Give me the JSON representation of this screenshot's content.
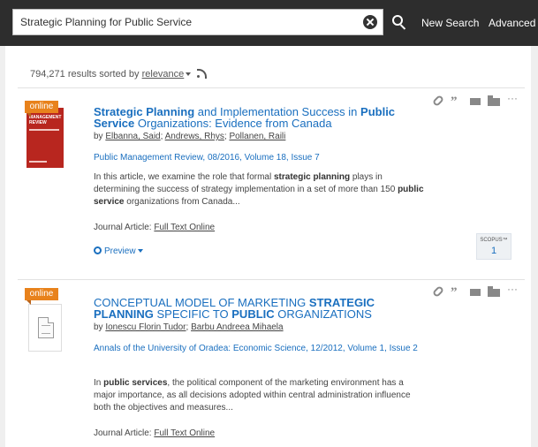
{
  "search": {
    "query": "Strategic Planning for Public Service",
    "new_search_label": "New Search",
    "advanced_label": "Advanced"
  },
  "summary": {
    "count_text": "794,271 results sorted by",
    "sort_value": "relevance"
  },
  "results": [
    {
      "badge": "online",
      "cover_text": "MANAGEMENT REVIEW",
      "title_segments": [
        {
          "text": "Strategic Planning",
          "bold": true
        },
        {
          "text": " and Implementation Success in ",
          "bold": false
        },
        {
          "text": "Public Service",
          "bold": true
        },
        {
          "text": " Organizations: Evidence from Canada",
          "bold": false
        }
      ],
      "by": "by ",
      "authors": [
        "Elbanna, Said",
        "Andrews, Rhys",
        "Pollanen, Raili"
      ],
      "source": "Public Management Review, 08/2016, Volume 18, Issue 7",
      "snippet_segments": [
        {
          "text": "In this article, we examine the role that formal ",
          "bold": false
        },
        {
          "text": "strategic planning",
          "bold": true
        },
        {
          "text": " plays in determining the success of strategy implementation in a set of more than 150 ",
          "bold": false
        },
        {
          "text": "public service",
          "bold": true
        },
        {
          "text": " organizations from Canada...",
          "bold": false
        }
      ],
      "format_label": "Journal Article: ",
      "format_link": "Full Text Online",
      "preview_label": "Preview",
      "scopus_label": "SCOPUS™",
      "scopus_count": "1"
    },
    {
      "badge": "online",
      "title_segments": [
        {
          "text": "CONCEPTUAL MODEL OF MARKETING ",
          "bold": false
        },
        {
          "text": "STRATEGIC PLANNING",
          "bold": true
        },
        {
          "text": " SPECIFIC TO ",
          "bold": false
        },
        {
          "text": "PUBLIC",
          "bold": true
        },
        {
          "text": " ORGANIZATIONS",
          "bold": false
        }
      ],
      "by": "by ",
      "authors": [
        "Ionescu Florin Tudor",
        "Barbu Andreea Mihaela"
      ],
      "source": "Annals of the University of Oradea: Economic Science, 12/2012, Volume 1, Issue 2",
      "snippet_segments": [
        {
          "text": "In ",
          "bold": false
        },
        {
          "text": "public services",
          "bold": true
        },
        {
          "text": ", the political component of the marketing environment has a major importance, as all decisions adopted within central administration influence both the objectives and measures...",
          "bold": false
        }
      ],
      "format_label": "Journal Article: ",
      "format_link": "Full Text Online"
    }
  ],
  "action_icons": [
    "link-icon",
    "quote-icon",
    "email-icon",
    "folder-icon",
    "more-icon"
  ]
}
